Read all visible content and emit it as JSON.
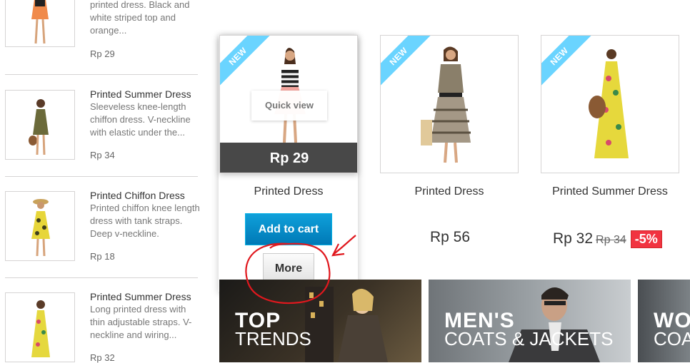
{
  "sidebar": {
    "items": [
      {
        "title": "",
        "desc": "printed dress. Black and white striped top and orange...",
        "price": "Rp 29"
      },
      {
        "title": "Printed Summer Dress",
        "desc": "Sleeveless knee-length chiffon dress. V-neckline with elastic under the...",
        "price": "Rp 34"
      },
      {
        "title": "Printed Chiffon Dress",
        "desc": "Printed chiffon knee length dress with tank straps. Deep v-neckline.",
        "price": "Rp 18"
      },
      {
        "title": "Printed Summer Dress",
        "desc": "Long printed dress with thin adjustable straps. V-neckline and wiring...",
        "price": "Rp 32"
      }
    ]
  },
  "products": [
    {
      "badge": "NEW",
      "quick_view": "Quick view",
      "hover_price": "Rp 29",
      "name": "Printed Dress",
      "add_to_cart": "Add to cart",
      "more": "More"
    },
    {
      "badge": "NEW",
      "name": "Printed Dress",
      "price": "Rp 56"
    },
    {
      "badge": "NEW",
      "name": "Printed Summer Dress",
      "price": "Rp 32",
      "old_price": "Rp 34",
      "discount": "-5%"
    }
  ],
  "banners": [
    {
      "title": "TOP",
      "subtitle": "TRENDS"
    },
    {
      "title": "MEN'S",
      "subtitle": "COATS & JACKETS"
    },
    {
      "title": "WO",
      "subtitle": "COAT"
    }
  ],
  "colors": {
    "ribbon": "#6ad4ff",
    "cart_button": "#0089c8",
    "discount": "#f13340",
    "annotation": "#e0181e",
    "price_bar": "#484848"
  }
}
